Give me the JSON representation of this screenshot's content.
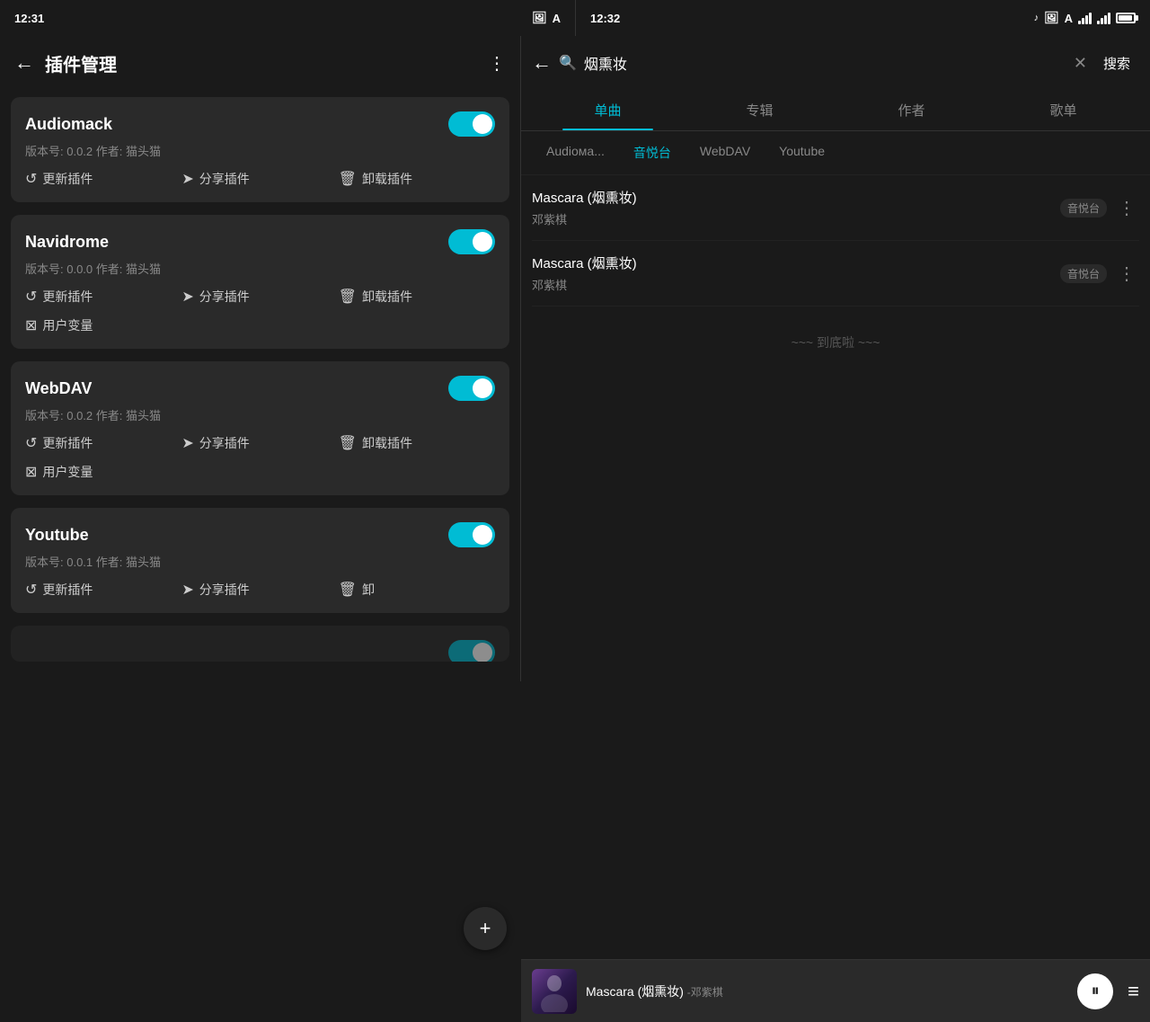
{
  "left_status": {
    "time": "12:31"
  },
  "right_status": {
    "time": "12:32"
  },
  "left_panel": {
    "back_label": "←",
    "title": "插件管理",
    "more_label": "⋮",
    "plugins": [
      {
        "name": "Audiomack",
        "version": "版本号: 0.0.2  作者: 猫头猫",
        "enabled": true,
        "actions": [
          "更新插件",
          "分享插件",
          "卸载插件"
        ],
        "extra_actions": []
      },
      {
        "name": "Navidrome",
        "version": "版本号: 0.0.0  作者: 猫头猫",
        "enabled": true,
        "actions": [
          "更新插件",
          "分享插件",
          "卸载插件"
        ],
        "extra_actions": [
          "用户变量"
        ]
      },
      {
        "name": "WebDAV",
        "version": "版本号: 0.0.2  作者: 猫头猫",
        "enabled": true,
        "actions": [
          "更新插件",
          "分享插件",
          "卸载插件"
        ],
        "extra_actions": [
          "用户变量"
        ]
      },
      {
        "name": "Youtube",
        "version": "版本号: 0.0.1  作者: 猫头猫",
        "enabled": true,
        "actions": [
          "更新插件",
          "分享插件",
          "卸载"
        ],
        "extra_actions": []
      }
    ]
  },
  "right_panel": {
    "back_label": "←",
    "search_placeholder": "烟熏妆",
    "search_query": "烟熏妆",
    "clear_label": "✕",
    "search_btn_label": "搜索",
    "tabs": [
      "单曲",
      "专辑",
      "作者",
      "歌单"
    ],
    "active_tab": "单曲",
    "source_tabs": [
      "Audioма...",
      "音悦台",
      "WebDAV",
      "Youtube"
    ],
    "active_source": "音悦台",
    "results": [
      {
        "title": "Mascara (烟熏妆)",
        "artist": "邓紫棋",
        "source": "音悦台"
      },
      {
        "title": "Mascara (烟熏妆)",
        "artist": "邓紫棋",
        "source": "音悦台"
      }
    ],
    "end_text": "~~~ 到底啦 ~~~",
    "now_playing": {
      "title": "Mascara (烟熏妆)",
      "artist": "-邓紫棋",
      "pause_icon": "⏸",
      "playlist_icon": "≡"
    }
  },
  "icons": {
    "back": "←",
    "more": "⋮",
    "update": "↺",
    "share": "➤",
    "delete": "🗑",
    "variable": "⊠",
    "search": "🔍",
    "clear": "✕",
    "pause": "⏸",
    "playlist": "≡",
    "plus": "+"
  }
}
